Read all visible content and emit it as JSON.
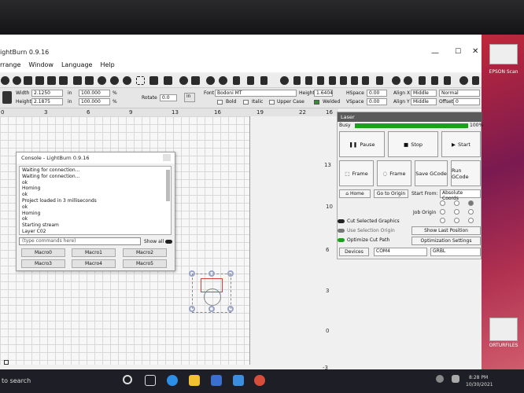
{
  "app": {
    "title": "ightBurn 0.9.16",
    "menu": [
      "rrange",
      "Window",
      "Language",
      "Help"
    ]
  },
  "props": {
    "width_label": "Width",
    "width_value": "2.1250",
    "width_unit": "in",
    "height_label": "Height",
    "height_value": "2.1875",
    "height_unit": "in",
    "scale_w": "100.000",
    "scale_h": "100.000",
    "pct": "%",
    "rotate_label": "Rotate",
    "rotate_value": "0.0",
    "units_btn": "in",
    "font_label": "Font",
    "font_value": "Bodoni MT",
    "fheight_label": "Height",
    "fheight_value": "1.6404",
    "hspace_label": "HSpace",
    "hspace_value": "0.00",
    "vspace_label": "VSpace",
    "vspace_value": "0.00",
    "alignx_label": "Align X",
    "alignx_value": "Middle",
    "aligny_label": "Align Y",
    "aligny_value": "Middle",
    "style_value": "Normal",
    "offset_label": "Offset",
    "offset_value": "0",
    "bold": "Bold",
    "italic": "Italic",
    "upper": "Upper Case",
    "welded": "Welded"
  },
  "ruler": [
    "0",
    "3",
    "6",
    "9",
    "13",
    "16",
    "19",
    "22",
    "16"
  ],
  "yaxis": [
    "13",
    "10",
    "6",
    "3",
    "0",
    "-3"
  ],
  "console": {
    "title": "Console - LightBurn 0.9.16",
    "lines": [
      "Waiting for connection...",
      "Waiting for connection...",
      "ok",
      "Homing",
      "ok",
      "Project loaded in 3 milliseconds",
      "ok",
      "Homing",
      "ok",
      "Starting stream",
      "Layer C02"
    ],
    "placeholder": "(type commands here)",
    "show_all": "Show all",
    "macros": [
      "Macro0",
      "Macro1",
      "Macro2",
      "Macro3",
      "Macro4",
      "Macro5"
    ]
  },
  "laser": {
    "title": "Laser",
    "status": "Busy",
    "progress_pct": 100,
    "progress_text": "100%",
    "pause": "Pause",
    "stop": "Stop",
    "start": "Start",
    "frame1": "Frame",
    "frame2": "Frame",
    "save_gcode": "Save GCode",
    "run_gcode": "Run GCode",
    "home": "Home",
    "go_origin": "Go to Origin",
    "start_from_label": "Start From:",
    "start_from_value": "Absolute Coords",
    "job_origin": "Job Origin",
    "cut_selected": "Cut Selected Graphics",
    "use_selection_origin": "Use Selection Origin",
    "optimize": "Optimize Cut Path",
    "show_last": "Show Last Position",
    "opt_settings": "Optimization Settings",
    "devices": "Devices",
    "port": "COM4",
    "controller": "GRBL"
  },
  "desktop": {
    "icon1": "EPSON Scan",
    "icon2": "ORTURFILES"
  },
  "taskbar": {
    "search": "to search",
    "time": "8:28 PM",
    "date": "10/30/2021"
  },
  "colors": {
    "progress": "#19a119",
    "laser_title": "#5a5a5a",
    "accent": "#1b6fd1"
  }
}
